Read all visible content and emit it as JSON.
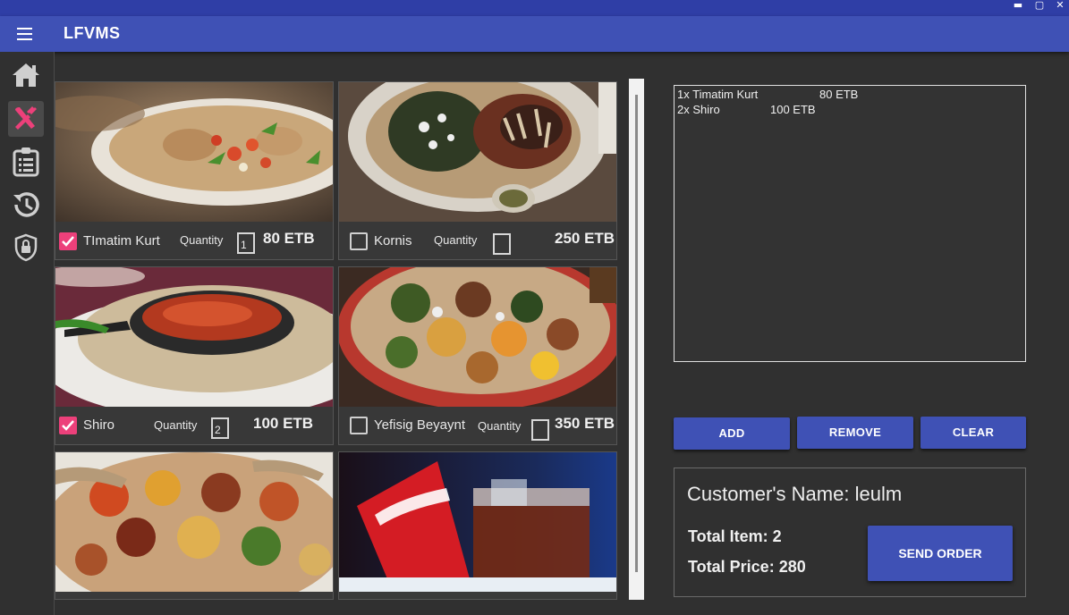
{
  "window": {
    "minimize": "▬",
    "maximize": "▢",
    "close": "✕"
  },
  "app": {
    "title": "LFVMS"
  },
  "sidebar": {
    "items": [
      {
        "icon": "home-icon",
        "active": false
      },
      {
        "icon": "utensils-icon",
        "active": true
      },
      {
        "icon": "clipboard-list-icon",
        "active": false
      },
      {
        "icon": "history-icon",
        "active": false
      },
      {
        "icon": "shield-lock-icon",
        "active": false
      }
    ]
  },
  "menu": [
    {
      "name": "TImatim Kurt",
      "quantity_label": "Quantity",
      "quantity": "1",
      "price": "80 ETB",
      "checked": true,
      "photo": "timatim-kurt-photo"
    },
    {
      "name": "Kornis",
      "quantity_label": "Quantity",
      "quantity": "",
      "price": "250 ETB",
      "checked": false,
      "photo": "kornis-photo"
    },
    {
      "name": "Shiro",
      "quantity_label": "Quantity",
      "quantity": "2",
      "price": "100 ETB",
      "checked": true,
      "photo": "shiro-photo"
    },
    {
      "name": "Yefisig Beyaynt",
      "quantity_label": "Quantity",
      "quantity": "",
      "price": "350 ETB",
      "checked": false,
      "photo": "yefisig-beyaynt-photo"
    },
    {
      "photo": "beyaynetu-platter-photo"
    },
    {
      "photo": "coca-cola-photo"
    }
  ],
  "order": {
    "lines": [
      {
        "item": "1x Timatim Kurt",
        "price": "80 ETB"
      },
      {
        "item": "2x Shiro",
        "price": "100 ETB"
      }
    ]
  },
  "actions": {
    "add": "ADD",
    "remove": "REMOVE",
    "clear": "CLEAR"
  },
  "summary": {
    "customer": "Customer's Name: leulm",
    "total_items": "Total Item: 2",
    "total_price": "Total Price: 280",
    "send": "SEND ORDER"
  },
  "colors": {
    "primary": "#3f51b5",
    "titlebar": "#2f3ea6",
    "accent": "#ec407a",
    "background": "#303030"
  }
}
